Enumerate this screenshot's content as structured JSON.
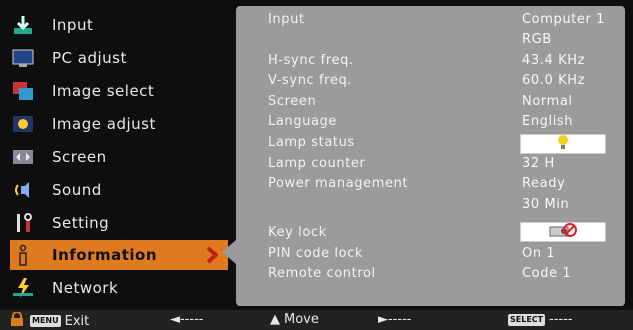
{
  "menu": {
    "items": [
      {
        "label": "Input",
        "icon": "input-icon"
      },
      {
        "label": "PC adjust",
        "icon": "pc-adjust-icon"
      },
      {
        "label": "Image select",
        "icon": "image-select-icon"
      },
      {
        "label": "Image adjust",
        "icon": "image-adjust-icon"
      },
      {
        "label": "Screen",
        "icon": "screen-icon"
      },
      {
        "label": "Sound",
        "icon": "sound-icon"
      },
      {
        "label": "Setting",
        "icon": "setting-icon"
      },
      {
        "label": "Information",
        "icon": "information-icon",
        "active": true
      },
      {
        "label": "Network",
        "icon": "network-icon"
      }
    ]
  },
  "info": {
    "rows": [
      {
        "label": "Input",
        "value": "Computer 1"
      },
      {
        "label": "",
        "value": "RGB"
      },
      {
        "label": "H-sync freq.",
        "value": "43.4  KHz"
      },
      {
        "label": "V-sync freq.",
        "value": "60.0  KHz"
      },
      {
        "label": "Screen",
        "value": "Normal"
      },
      {
        "label": "Language",
        "value": "English"
      },
      {
        "label": "Lamp status",
        "value": ""
      },
      {
        "label": "Lamp counter",
        "value": "32  H"
      },
      {
        "label": "Power management",
        "value": "Ready"
      },
      {
        "label": "",
        "value": "30  Min"
      },
      {
        "label": "Key lock",
        "value": ""
      },
      {
        "label": "PIN code lock",
        "value": "On 1"
      },
      {
        "label": "Remote control",
        "value": "Code 1"
      }
    ]
  },
  "footer": {
    "menu_key": "MENU",
    "exit": "Exit",
    "left": "◄-----",
    "move": "Move",
    "right": "►-----",
    "select_key": "SELECT",
    "select": "-----"
  },
  "colors": {
    "accent": "#e07a1f",
    "panel": "#9b9b9b"
  }
}
